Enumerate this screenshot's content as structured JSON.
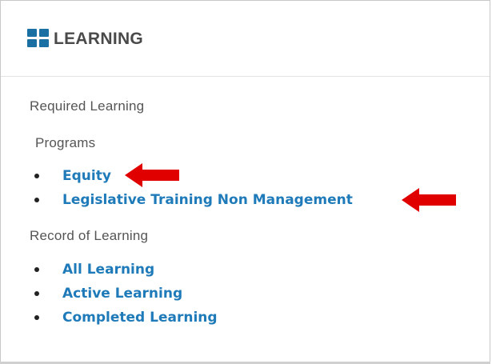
{
  "header": {
    "title": "LEARNING",
    "icon": "grid-icon",
    "icon_color": "#1a6fa3"
  },
  "required": {
    "label": "Required Learning",
    "programs_label": "Programs",
    "programs": [
      {
        "label": "Equity"
      },
      {
        "label": "Legislative Training Non Management"
      }
    ]
  },
  "record": {
    "label": "Record of Learning",
    "items": [
      {
        "label": "All Learning"
      },
      {
        "label": "Active Learning"
      },
      {
        "label": "Completed Learning"
      }
    ]
  },
  "colors": {
    "link": "#1e7ab8",
    "arrow": "#e00000"
  }
}
